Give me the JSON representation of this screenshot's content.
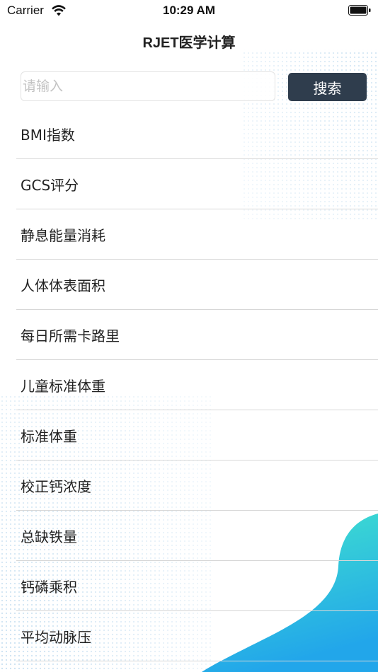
{
  "status_bar": {
    "carrier": "Carrier",
    "time": "10:29 AM",
    "wifi_icon": "wifi-icon",
    "battery_icon": "battery-icon"
  },
  "nav": {
    "title": "RJET医学计算"
  },
  "search": {
    "placeholder": "请输入",
    "value": "",
    "button_label": "搜索"
  },
  "colors": {
    "button_bg": "#2f3d4d",
    "accent_teal": "#3ee0cc",
    "accent_blue": "#2aa8ea",
    "separator": "#d7d7d7"
  },
  "list": {
    "items": [
      "BMI指数",
      "GCS评分",
      "静息能量消耗",
      "人体体表面积",
      "每日所需卡路里",
      "儿童标准体重",
      "标准体重",
      "校正钙浓度",
      "总缺铁量",
      "钙磷乘积",
      "平均动脉压"
    ]
  }
}
